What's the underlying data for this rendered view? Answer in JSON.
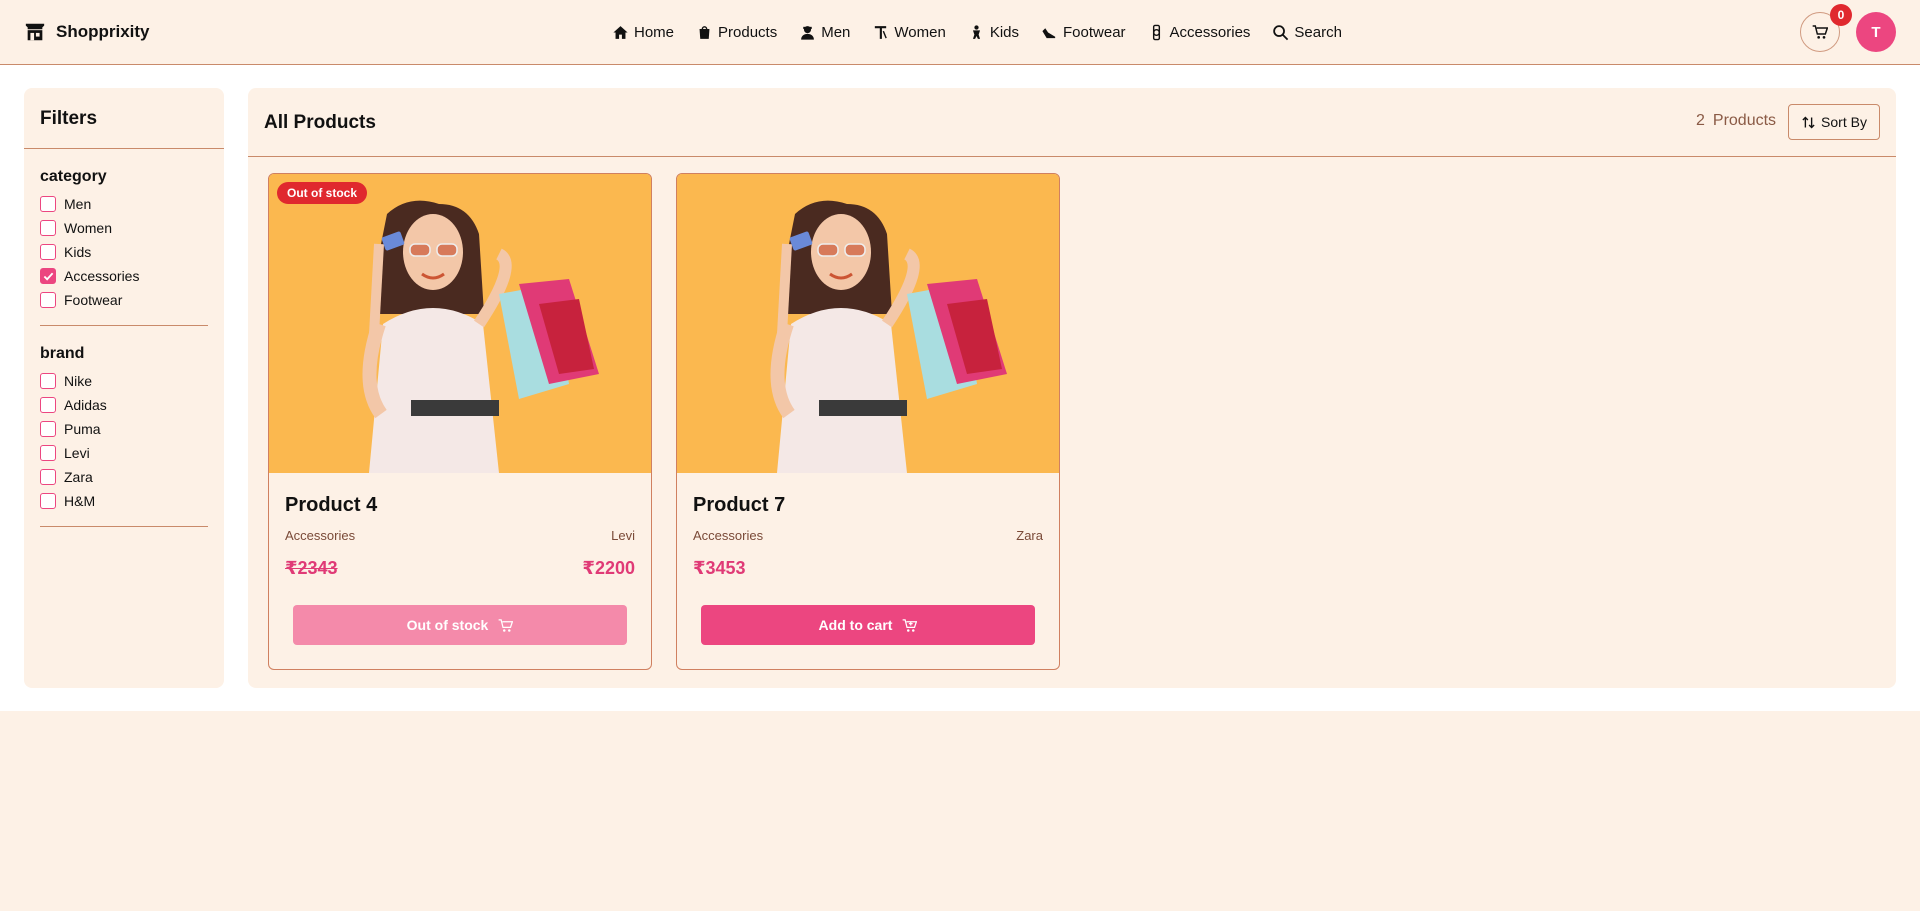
{
  "header": {
    "brand": "Shopprixity",
    "nav": [
      {
        "label": "Home",
        "icon": "home-icon"
      },
      {
        "label": "Products",
        "icon": "shopping-bag-icon"
      },
      {
        "label": "Men",
        "icon": "man-icon"
      },
      {
        "label": "Women",
        "icon": "woman-icon"
      },
      {
        "label": "Kids",
        "icon": "baby-icon"
      },
      {
        "label": "Footwear",
        "icon": "shoe-icon"
      },
      {
        "label": "Accessories",
        "icon": "watch-icon"
      },
      {
        "label": "Search",
        "icon": "search-icon"
      }
    ],
    "cart_count": "0",
    "avatar_initial": "T"
  },
  "filters": {
    "title": "Filters",
    "category": {
      "title": "category",
      "options": [
        {
          "label": "Men",
          "checked": false
        },
        {
          "label": "Women",
          "checked": false
        },
        {
          "label": "Kids",
          "checked": false
        },
        {
          "label": "Accessories",
          "checked": true
        },
        {
          "label": "Footwear",
          "checked": false
        }
      ]
    },
    "brand": {
      "title": "brand",
      "options": [
        {
          "label": "Nike",
          "checked": false
        },
        {
          "label": "Adidas",
          "checked": false
        },
        {
          "label": "Puma",
          "checked": false
        },
        {
          "label": "Levi",
          "checked": false
        },
        {
          "label": "Zara",
          "checked": false
        },
        {
          "label": "H&M",
          "checked": false
        }
      ]
    }
  },
  "listing": {
    "title": "All Products",
    "count": "2",
    "count_label": "Products",
    "sort_label": "Sort By"
  },
  "products": [
    {
      "name": "Product 4",
      "category": "Accessories",
      "brand": "Levi",
      "price": "₹2343",
      "sale_price": "₹2200",
      "badge": "Out of stock",
      "button": "Out of stock"
    },
    {
      "name": "Product 7",
      "category": "Accessories",
      "brand": "Zara",
      "price": "₹3453",
      "button": "Add to cart"
    }
  ],
  "colors": {
    "accent": "#ec4680",
    "badge": "#e0282e",
    "image_bg": "#fbb84f",
    "page_bg": "#fdf1e6"
  }
}
